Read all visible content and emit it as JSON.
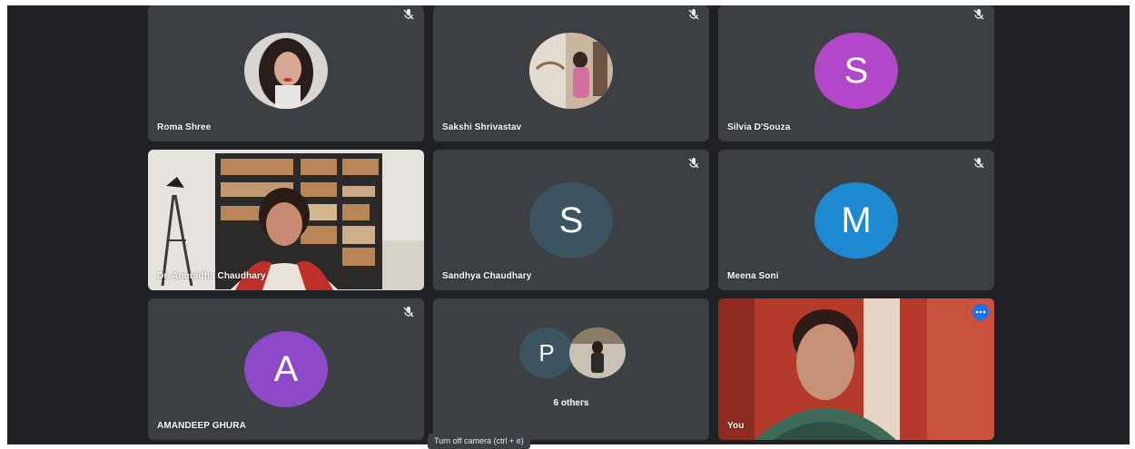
{
  "participants": [
    {
      "name": "Roma Shree",
      "type": "photo",
      "muted": true
    },
    {
      "name": "Sakshi Shrivastav",
      "type": "photo",
      "muted": true
    },
    {
      "name": "Silvia D'Souza",
      "type": "initial",
      "initial": "S",
      "color": "#b347c9",
      "muted": true
    },
    {
      "name": "Dr. Anuradha Chaudhary",
      "type": "video",
      "muted": false
    },
    {
      "name": "Sandhya Chaudhary",
      "type": "initial",
      "initial": "S",
      "color": "#3c5361",
      "muted": true
    },
    {
      "name": "Meena Soni",
      "type": "initial",
      "initial": "M",
      "color": "#1e88d0",
      "muted": true
    },
    {
      "name": "AMANDEEP GHURA",
      "type": "initial",
      "initial": "A",
      "color": "#8e49c9",
      "muted": true
    },
    {
      "name": "6 others",
      "type": "group",
      "initial": "P",
      "color": "#3c5361",
      "muted": false
    },
    {
      "name": "You",
      "type": "self-video",
      "muted": false
    }
  ],
  "tooltip": "Turn off camera (ctrl + e)",
  "icons": {
    "mute": "mic-off-icon",
    "more": "more-options-icon"
  }
}
